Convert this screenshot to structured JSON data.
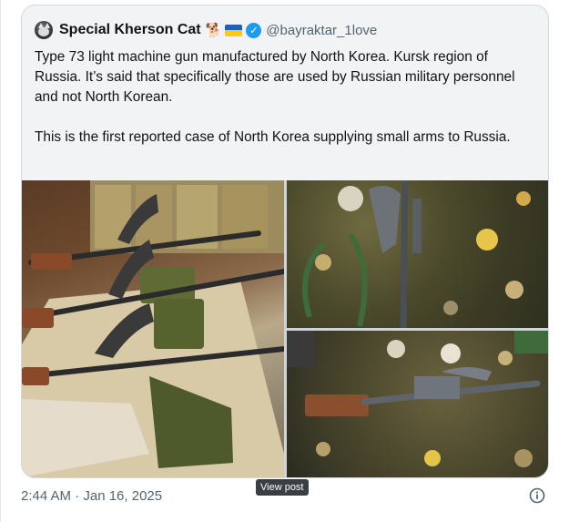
{
  "post": {
    "author_name": "Special Kherson Cat",
    "author_emoji": "🐕",
    "handle": "@bayraktar_1love",
    "paragraphs": [
      "Type 73 light machine gun manufactured by North Korea. Kursk region of Russia. It’s said that specifically those are used by Russian military personnel and not North Korean.",
      "This is the first reported case of North Korea supplying small arms to Russia."
    ],
    "timestamp": "2:44 AM · Jan 16, 2025"
  },
  "tooltip": {
    "label": "View post"
  },
  "icons": {
    "avatar": "cat-avatar",
    "flag": "ukraine-flag-icon",
    "verified": "verified-badge-icon",
    "info": "info-icon"
  },
  "colors": {
    "verified": "#1d9bf0",
    "card_bg": "#f1f3f4",
    "muted_text": "#536471",
    "flag_blue": "#1f5fbf",
    "flag_yellow": "#f5cb1a"
  }
}
